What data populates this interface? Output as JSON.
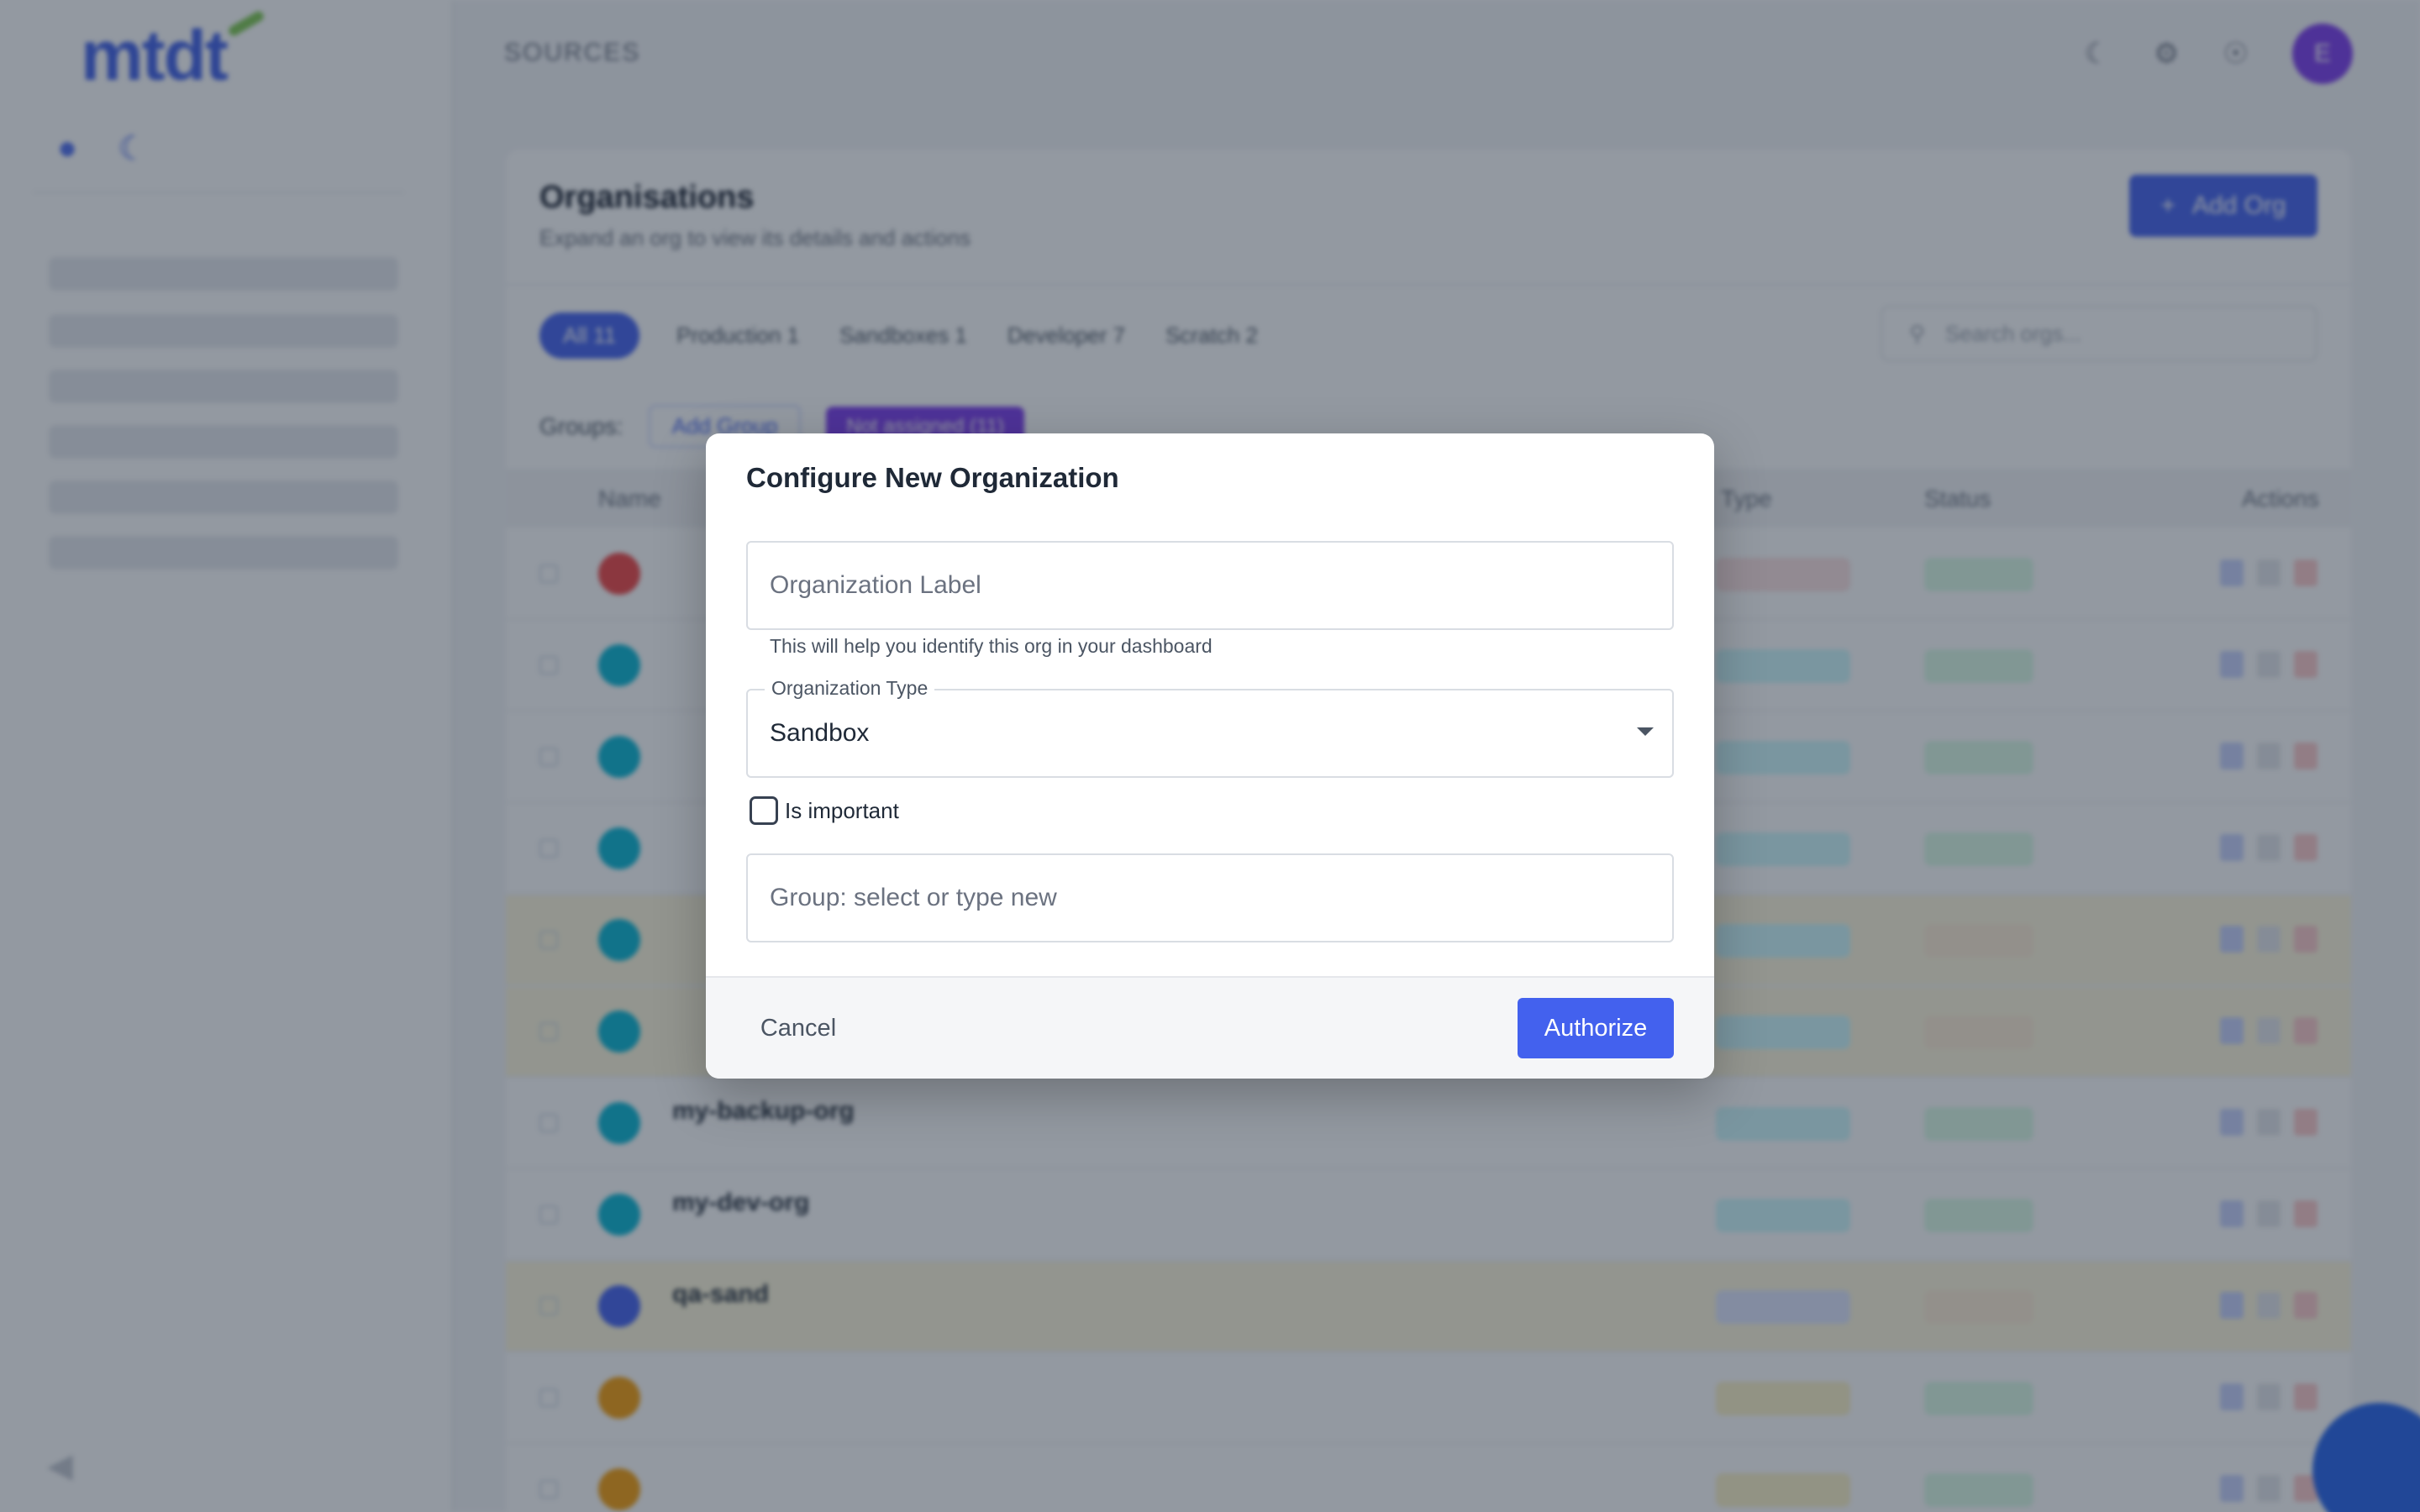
{
  "app": {
    "logo": "mtdt",
    "breadcrumb": "SOURCES",
    "avatar_initial": "E"
  },
  "panel": {
    "title": "Organisations",
    "subtitle": "Expand an org to view its details and actions",
    "add_org_label": "Add Org",
    "filters": [
      "All 11",
      "Production 1",
      "Sandboxes 1",
      "Developer 7",
      "Scratch 2"
    ],
    "search_placeholder": "Search orgs...",
    "groups_label": "Groups:",
    "add_group_label": "Add Group",
    "group_tag": "Not assigned (11)",
    "columns": {
      "name": "Name",
      "type": "Type",
      "status": "Status",
      "actions": "Actions"
    },
    "rows": [
      {
        "name": "",
        "user": "",
        "icon_color": "#ef4444",
        "type_color": "#fde2e2",
        "status_color": "#dcfce7",
        "warn": false
      },
      {
        "name": "",
        "user": "",
        "icon_color": "#06b6d4",
        "type_color": "#cffafe",
        "status_color": "#dcfce7",
        "warn": false
      },
      {
        "name": "",
        "user": "",
        "icon_color": "#06b6d4",
        "type_color": "#cffafe",
        "status_color": "#dcfce7",
        "warn": false
      },
      {
        "name": "",
        "user": "",
        "icon_color": "#06b6d4",
        "type_color": "#cffafe",
        "status_color": "#dcfce7",
        "warn": false
      },
      {
        "name": "",
        "user": "",
        "icon_color": "#06b6d4",
        "type_color": "#cffafe",
        "status_color": "#ffedd5",
        "warn": true
      },
      {
        "name": "",
        "user": "",
        "icon_color": "#06b6d4",
        "type_color": "#cffafe",
        "status_color": "#ffedd5",
        "warn": true
      },
      {
        "name": "my-backup-org",
        "user": "",
        "icon_color": "#06b6d4",
        "type_color": "#cffafe",
        "status_color": "#dcfce7",
        "warn": false
      },
      {
        "name": "my-dev-org",
        "user": "",
        "icon_color": "#06b6d4",
        "type_color": "#cffafe",
        "status_color": "#dcfce7",
        "warn": false
      },
      {
        "name": "qa-sand",
        "user": "",
        "icon_color": "#4361ee",
        "type_color": "#e0e7ff",
        "status_color": "#ffedd5",
        "warn": true
      },
      {
        "name": "",
        "user": "",
        "icon_color": "#f59e0b",
        "type_color": "#fef3c7",
        "status_color": "#dcfce7",
        "warn": false
      },
      {
        "name": "",
        "user": "",
        "icon_color": "#f59e0b",
        "type_color": "#fef3c7",
        "status_color": "#dcfce7",
        "warn": false
      }
    ]
  },
  "dialog": {
    "title": "Configure New Organization",
    "org_label_placeholder": "Organization Label",
    "org_label_value": "",
    "org_label_helper": "This will help you identify this org in your dashboard",
    "org_type_label": "Organization Type",
    "org_type_value": "Sandbox",
    "is_important_label": "Is important",
    "is_important_checked": false,
    "group_placeholder": "Group: select or type new",
    "group_value": "",
    "cancel_label": "Cancel",
    "authorize_label": "Authorize"
  },
  "colors": {
    "accent": "#4361ee",
    "scrim": "rgba(30,41,59,0.48)",
    "logo": "#3f5fe8"
  }
}
